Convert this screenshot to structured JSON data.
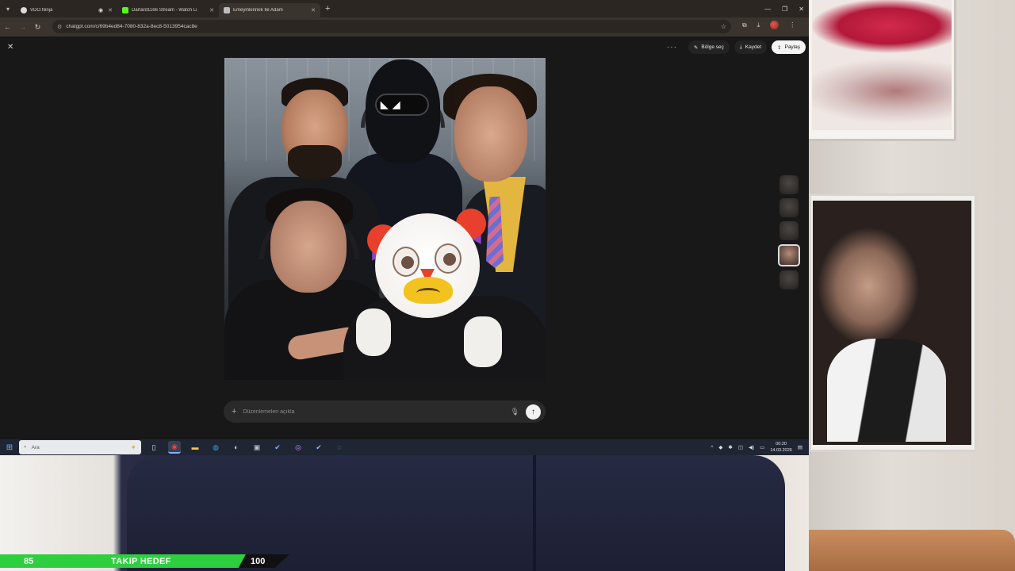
{
  "browser": {
    "tabs": [
      {
        "title": "VDO.Ninja",
        "favicon_color": "#dcdcdc",
        "recording": true
      },
      {
        "title": "Dartard1166 Stream - Watch Li",
        "favicon_color": "#53fc18",
        "recording": false
      },
      {
        "title": "Emeyinlerinek İle Adam",
        "favicon_color": "#bdbdbd",
        "recording": false
      }
    ],
    "url": "chatgpt.com/c/69b4ed84-7080-832a-8ec8-5013954cac8e"
  },
  "viewer": {
    "actions": {
      "select_area": "Bölge seç",
      "save": "Kaydet",
      "share": "Paylaş"
    },
    "prompt_placeholder": "Düzenlemeleri açıkla",
    "thumbnail_count": 5,
    "selected_thumbnail": 4
  },
  "taskbar": {
    "search_placeholder": "Ara",
    "time": "00:20",
    "date": "14.03.2026"
  },
  "overlay": {
    "goal_current": "85",
    "goal_label": "TAKIP HEDEF",
    "goal_target": "100",
    "goal_fraction": 0.85,
    "goal_color": "#2ecf3f"
  }
}
